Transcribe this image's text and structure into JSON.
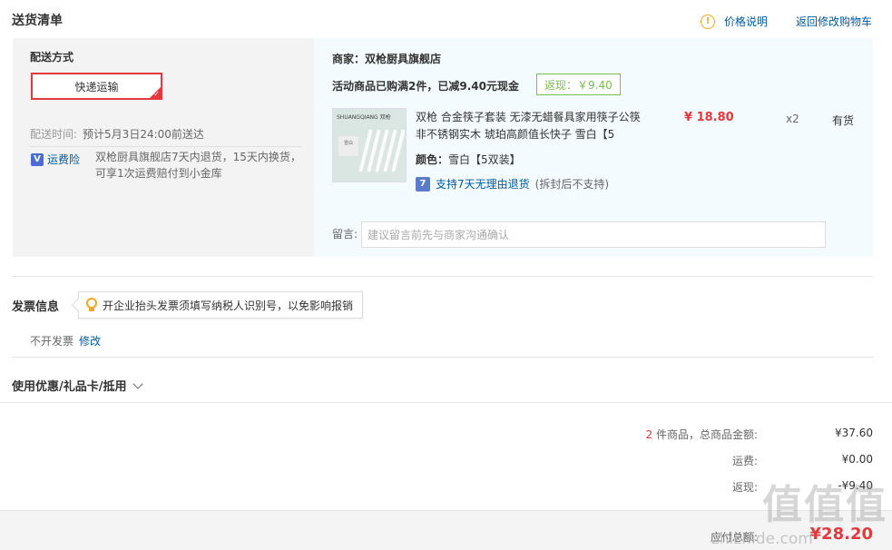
{
  "header": {
    "title": "送货清单",
    "price_help": "价格说明",
    "back_to_cart": "返回修改购物车",
    "icons": {
      "warning": "exclamation-circle-icon"
    }
  },
  "delivery": {
    "title": "配送方式",
    "method": "快递运输",
    "time_label": "配送时间:",
    "time_value": "预计5月3日24:00前送达",
    "insurance_label": "运费险",
    "insurance_text": "双枪厨具旗舰店7天内退货，15天内换货，可享1次运费赔付到小金库"
  },
  "order": {
    "shop": "商家：双枪厨具旗舰店",
    "promo": "活动商品已购满2件，已减9.40元现金",
    "rebate_tag": "返现：￥9.40",
    "product": {
      "name": "双枪 合金筷子套装 无漆无蜡餐具家用筷子公筷非不锈钢实木 琥珀高颜值长快子 雪白【5",
      "color_label": "颜色：",
      "color_value": "雪白【5双装】",
      "return_policy": "支持7天无理由退货",
      "return_note": "(拆封后不支持)",
      "price": "¥ 18.80",
      "qty": "x2",
      "stock": "有货",
      "thumb_brand": "SHUANGQIANG 双枪",
      "thumb_box": "雪白"
    },
    "note_label": "留言:",
    "note_placeholder": "建议留言前先与商家沟通确认"
  },
  "invoice": {
    "title": "发票信息",
    "tip": "开企业抬头发票须填写纳税人识别号，以免影响报销",
    "value": "不开发票",
    "edit": "修改"
  },
  "coupon": {
    "title": "使用优惠/礼品卡/抵用"
  },
  "summary": {
    "count": "2",
    "count_suffix": "件商品，总商品金额:",
    "total_goods": "¥37.60",
    "shipping_label": "运费:",
    "shipping": "¥0.00",
    "rebate_label": "返现:",
    "rebate": "-¥9.40",
    "payable_label": "应付总额:",
    "payable": "¥28.20"
  },
  "watermark": {
    "logo": "值值值",
    "site": "zhizhide.com"
  },
  "colors": {
    "accent_red": "#e4393c",
    "link_blue": "#005aa0",
    "rebate_green": "#7abd54"
  }
}
